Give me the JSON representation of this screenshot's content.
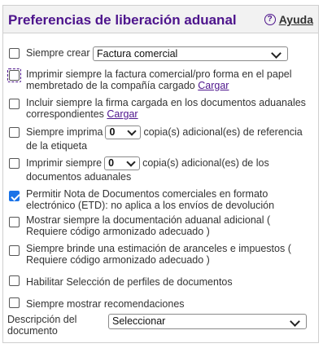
{
  "header": {
    "title": "Preferencias de liberación aduanal",
    "help_icon": "?",
    "help_label": "Ayuda"
  },
  "options": {
    "always_create": {
      "checked": false,
      "label": "Siempre crear",
      "select_value": "Factura comercial"
    },
    "print_invoice": {
      "checked": false,
      "focused": true,
      "label": "Imprimir siempre la factura comercial/pro forma en el papel membretado de la compañía cargado",
      "link": "Cargar"
    },
    "include_signature": {
      "checked": false,
      "label": "Incluir siempre la firma cargada en los documentos aduanales correspondientes",
      "link": "Cargar"
    },
    "print_label_copies": {
      "checked": false,
      "label_before": "Siempre imprima",
      "value": "0",
      "label_after": "copia(s) adicional(es) de referencia de la etiqueta"
    },
    "print_doc_copies": {
      "checked": false,
      "label_before": "Imprimir siempre",
      "value": "0",
      "label_after": "copia(s) adicional(es) de los documentos aduanales"
    },
    "etd": {
      "checked": true,
      "label": "Permitir Nota de Documentos comerciales en formato electrónico (ETD): no aplica a los envíos de devolución"
    },
    "show_docs": {
      "checked": false,
      "label": "Mostrar siempre la documentación aduanal adicional ( Requiere código armonizado adecuado )"
    },
    "estimate": {
      "checked": false,
      "label": "Siempre brinde una estimación de aranceles e impuestos ( Requiere código armonizado adecuado )"
    },
    "profiles": {
      "checked": false,
      "label": "Habilitar Selección de perfiles de documentos"
    },
    "recommendations": {
      "checked": false,
      "label": "Siempre mostrar recomendaciones"
    }
  },
  "doc_description": {
    "label": "Descripción del documento",
    "select_value": "Seleccionar"
  }
}
